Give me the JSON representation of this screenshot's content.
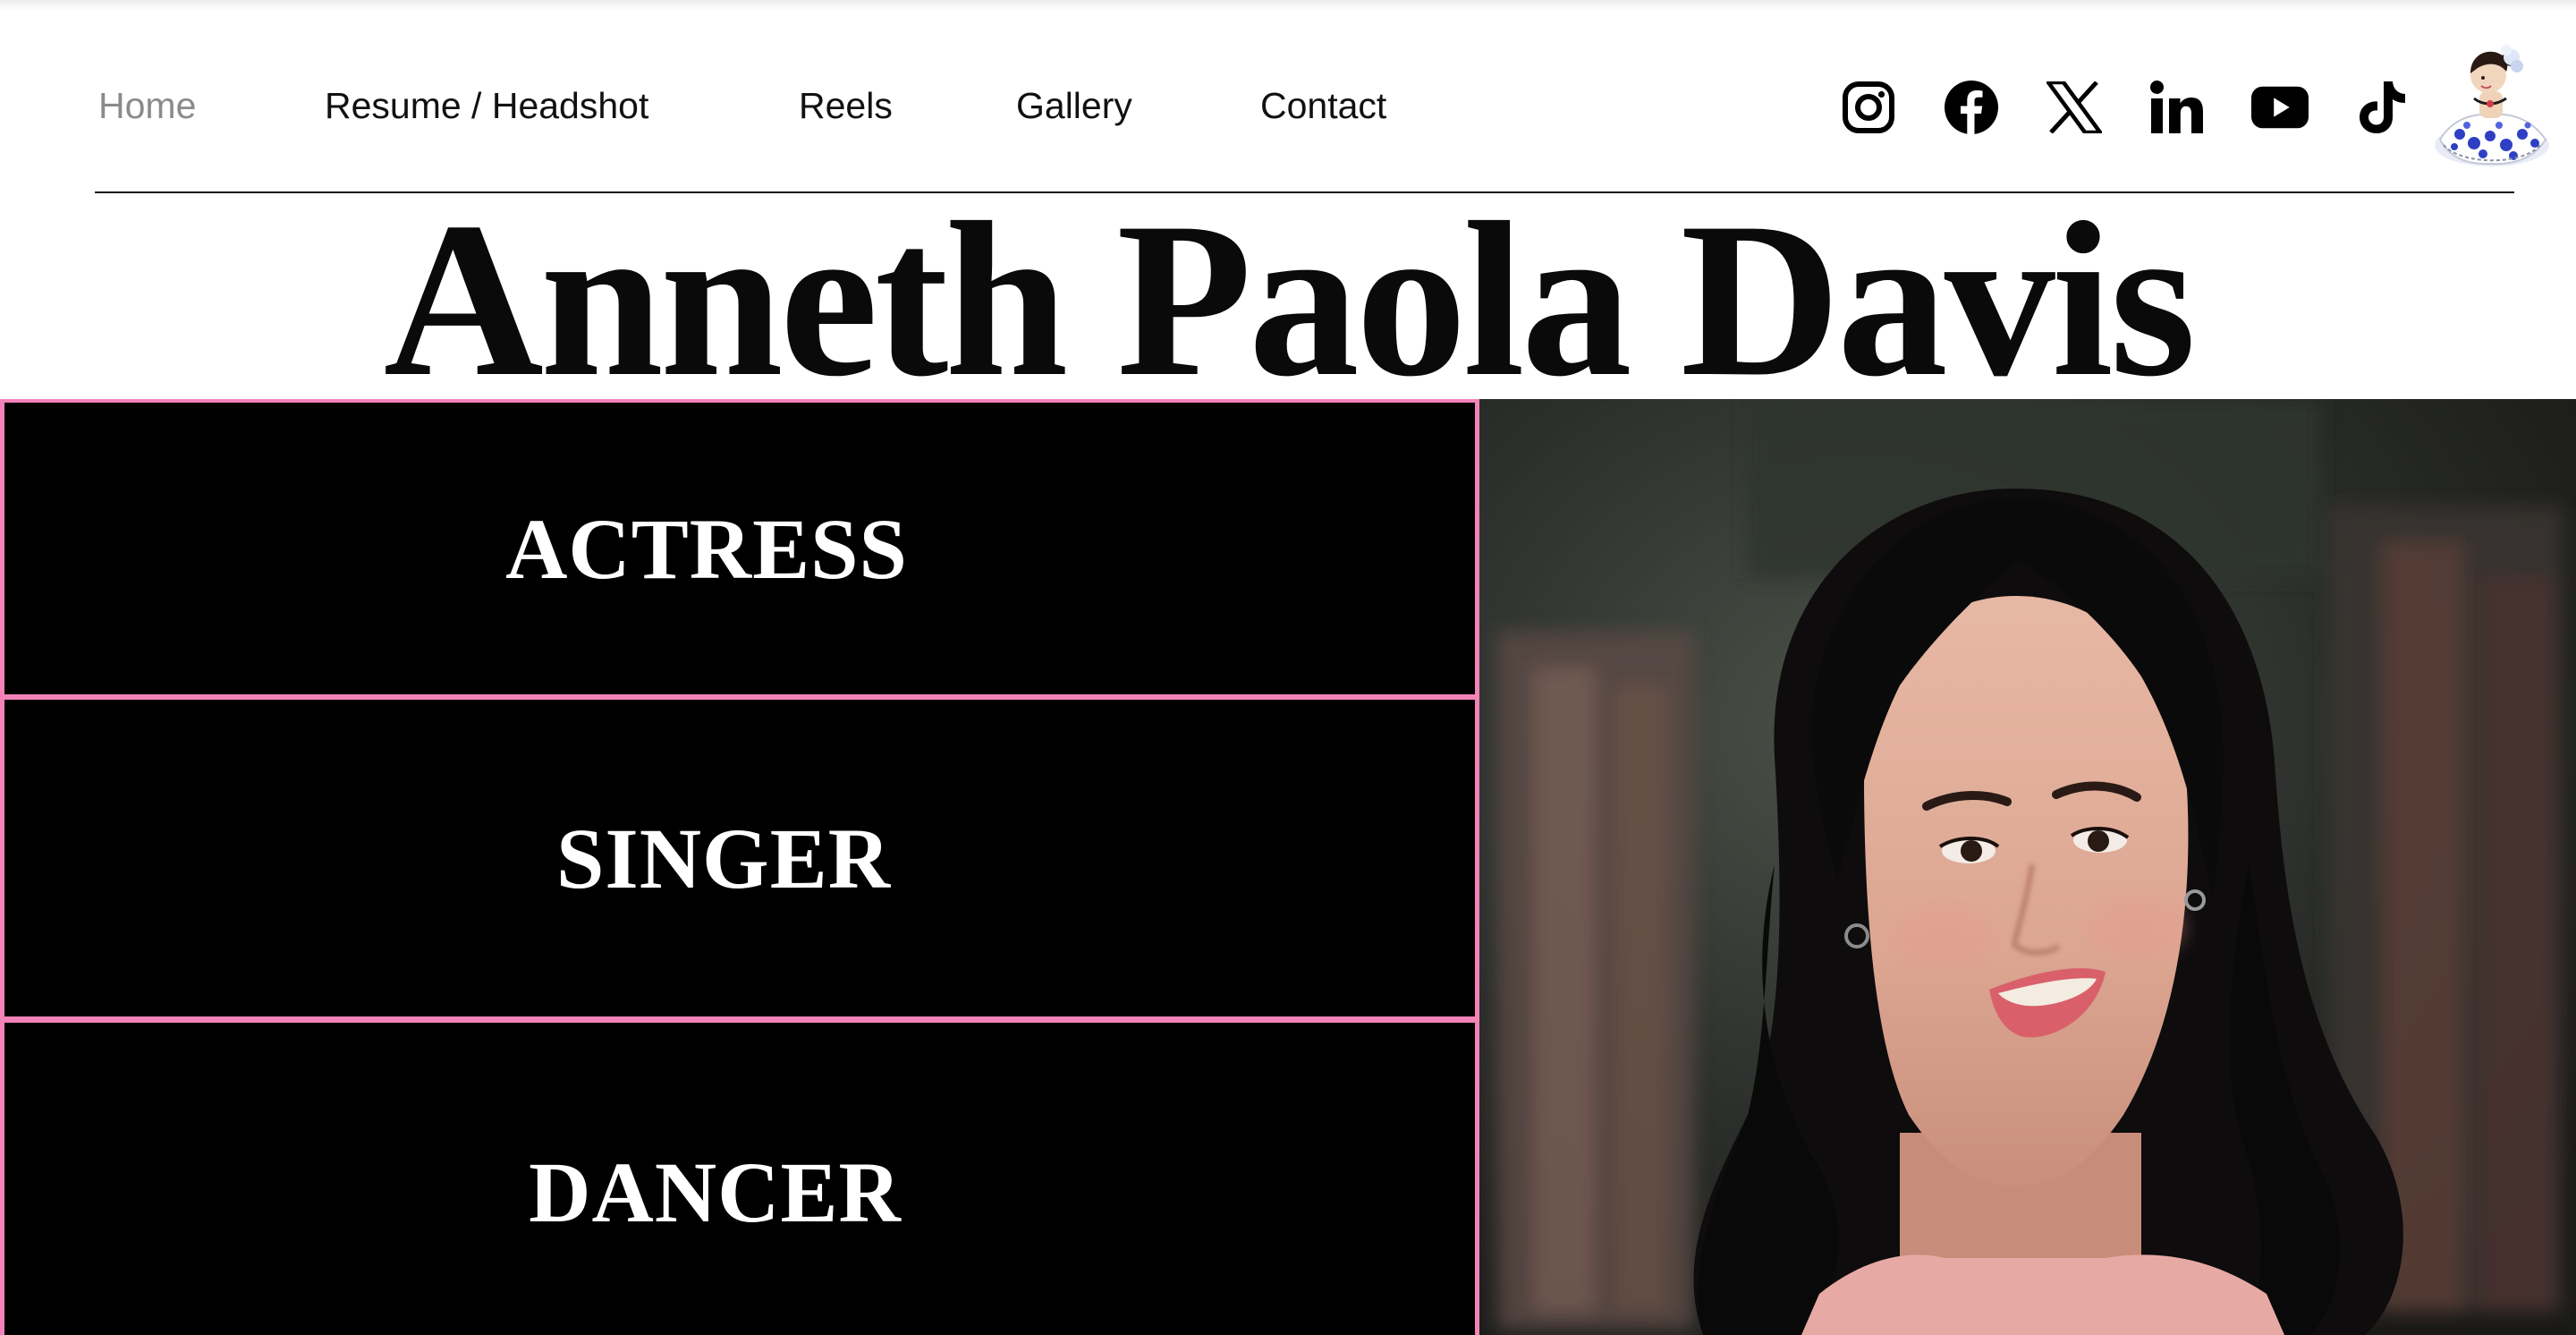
{
  "nav": {
    "items": [
      {
        "label": "Home",
        "active": true
      },
      {
        "label": "Resume / Headshot",
        "active": false
      },
      {
        "label": "Reels",
        "active": false
      },
      {
        "label": "Gallery",
        "active": false
      },
      {
        "label": "Contact",
        "active": false
      }
    ]
  },
  "social": [
    "instagram-icon",
    "facebook-icon",
    "x-icon",
    "linkedin-icon",
    "youtube-icon",
    "tiktok-icon"
  ],
  "site_title": "Anneth Paola Davis",
  "roles": [
    "ACTRESS",
    "SINGER",
    "DANCER"
  ],
  "colors": {
    "accent_border": "#f283b8",
    "panel_bg": "#000000",
    "nav_active": "#8b8b8b",
    "text": "#111111"
  }
}
